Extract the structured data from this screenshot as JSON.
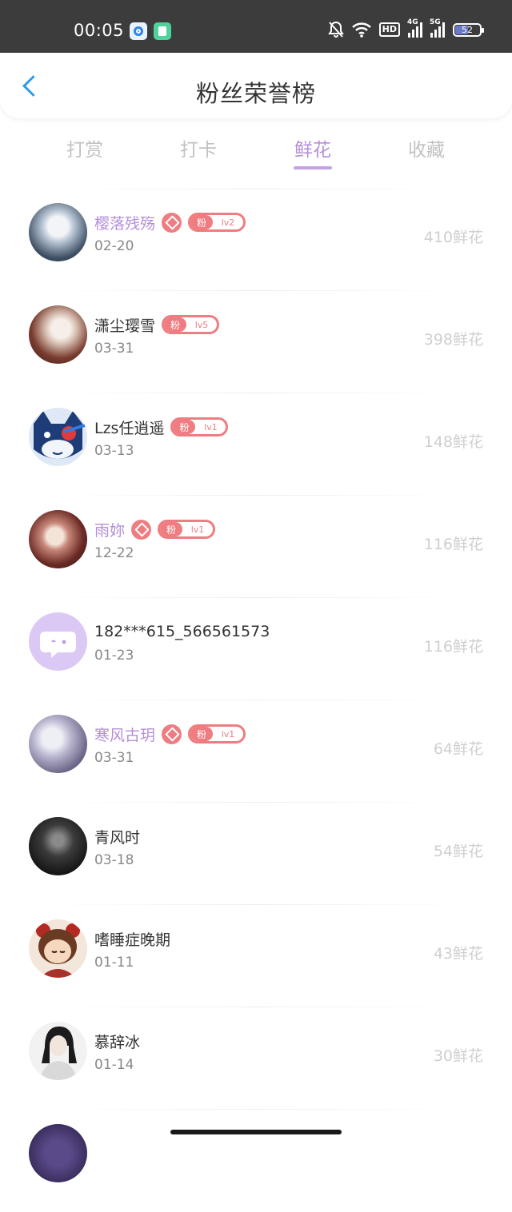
{
  "status": {
    "time": "00:05",
    "hd": "HD",
    "net1": "4G",
    "net2": "5G",
    "battery": "52"
  },
  "header": {
    "title": "粉丝荣誉榜"
  },
  "tabs": [
    {
      "label": "打赏",
      "active": false
    },
    {
      "label": "打卡",
      "active": false
    },
    {
      "label": "鲜花",
      "active": true
    },
    {
      "label": "收藏",
      "active": false
    }
  ],
  "badge_prefix": "粉",
  "fans": [
    {
      "name": "樱落残殇",
      "date": "02-20",
      "amount": "410鲜花",
      "vip": true,
      "level": "lv2"
    },
    {
      "name": "潇尘璎雪",
      "date": "03-31",
      "amount": "398鲜花",
      "vip": false,
      "level": "lv5"
    },
    {
      "name": "Lzs任逍遥",
      "date": "03-13",
      "amount": "148鲜花",
      "vip": false,
      "level": "lv1"
    },
    {
      "name": "雨妳",
      "date": "12-22",
      "amount": "116鲜花",
      "vip": true,
      "level": "lv1"
    },
    {
      "name": "182***615_566561573",
      "date": "01-23",
      "amount": "116鲜花",
      "vip": false,
      "level": ""
    },
    {
      "name": "寒风古玥",
      "date": "03-31",
      "amount": "64鲜花",
      "vip": true,
      "level": "lv1"
    },
    {
      "name": "青风时",
      "date": "03-18",
      "amount": "54鲜花",
      "vip": false,
      "level": ""
    },
    {
      "name": "嗜睡症晚期",
      "date": "01-11",
      "amount": "43鲜花",
      "vip": false,
      "level": ""
    },
    {
      "name": "慕辞冰",
      "date": "01-14",
      "amount": "30鲜花",
      "vip": false,
      "level": ""
    }
  ],
  "colors": {
    "accent": "#b48ed8",
    "badge": "#ef7c80",
    "back": "#2d9be8",
    "statusbar": "#3c3c3c"
  }
}
